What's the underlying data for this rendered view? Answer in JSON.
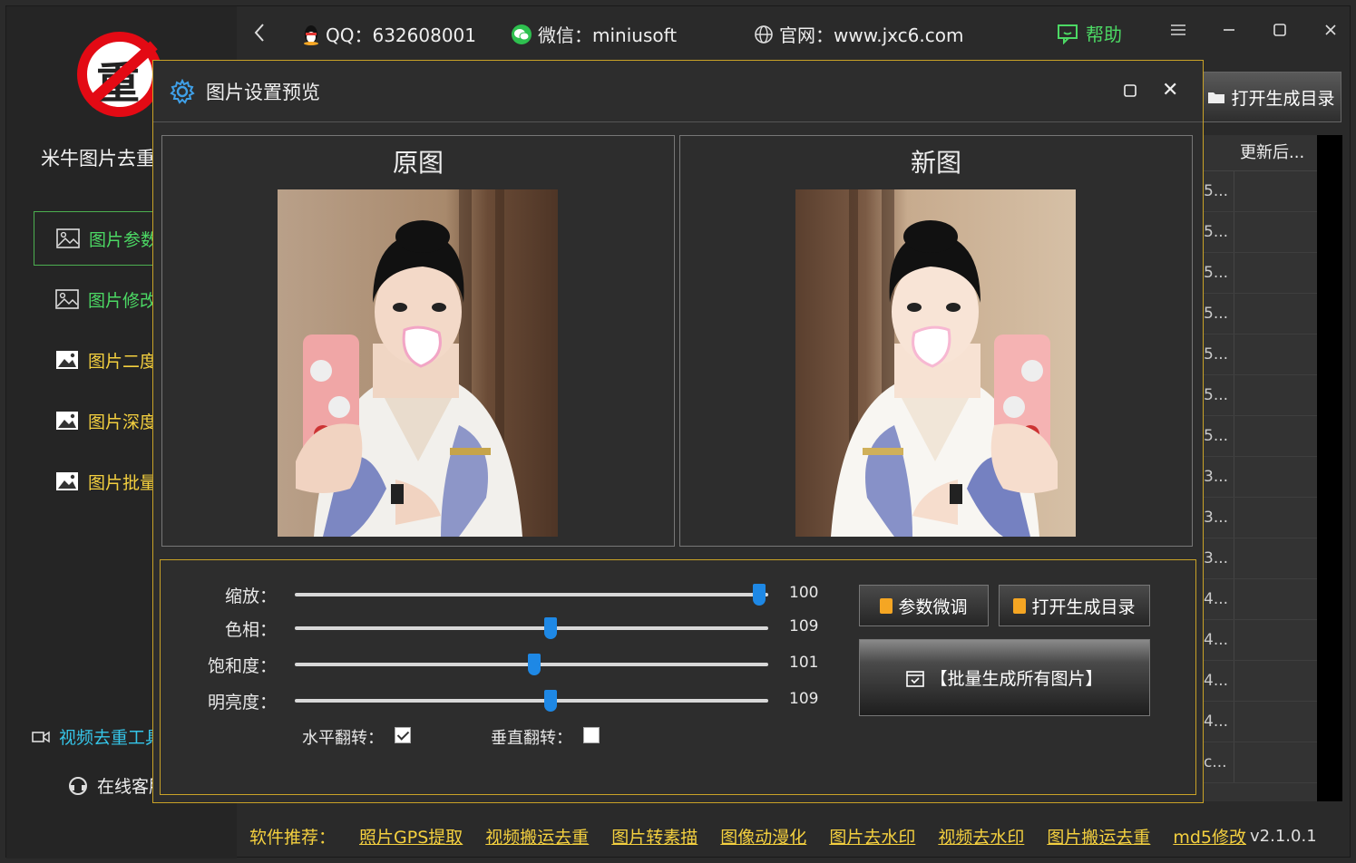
{
  "topbar": {
    "back_icon": "chevron-left-icon",
    "qq": "QQ：632608001",
    "wechat": "微信：miniusoft",
    "website": "官网：www.jxc6.com",
    "help": "帮助"
  },
  "sidebar": {
    "app_name": "米牛图片去重",
    "items": [
      {
        "label": "图片参数",
        "icon": "image-outline-icon"
      },
      {
        "label": "图片修改",
        "icon": "image-outline-icon"
      },
      {
        "label": "图片二度",
        "icon": "image-filled-icon"
      },
      {
        "label": "图片深度",
        "icon": "image-filled-icon"
      },
      {
        "label": "图片批量",
        "icon": "image-filled-icon"
      }
    ],
    "video_item": "视频去重工具",
    "online_item": "在线客服"
  },
  "right_panel": {
    "open_dir": "打开生成目录",
    "header": "更新后...",
    "rows": [
      "5...",
      "5...",
      "5...",
      "5...",
      "5...",
      "5...",
      "5...",
      "3...",
      "3...",
      "3...",
      "4...",
      "4...",
      "4...",
      "4...",
      "c..."
    ]
  },
  "dialog": {
    "title": "图片设置预览",
    "original_caption": "原图",
    "new_caption": "新图",
    "sliders": [
      {
        "label": "缩放：",
        "value": 100,
        "fraction": 0.98
      },
      {
        "label": "色相：",
        "value": 109,
        "fraction": 0.54
      },
      {
        "label": "饱和度：",
        "value": 101,
        "fraction": 0.505
      },
      {
        "label": "明亮度：",
        "value": 109,
        "fraction": 0.54
      }
    ],
    "flip_h_label": "水平翻转：",
    "flip_h_checked": true,
    "flip_v_label": "垂直翻转：",
    "flip_v_checked": false,
    "btn_fine_tune": "参数微调",
    "btn_open_dir": "打开生成目录",
    "btn_batch": "【批量生成所有图片】"
  },
  "footer": {
    "label": "软件推荐：",
    "links": [
      "照片GPS提取",
      "视频搬运去重",
      "图片转素描",
      "图像动漫化",
      "图片去水印",
      "视频去水印",
      "图片搬运去重",
      "md5修改"
    ],
    "version": "v2.1.0.1"
  },
  "colors": {
    "accent_green": "#4cd964",
    "accent_yellow": "#f4d03f",
    "dialog_border": "#c9a227",
    "slider_thumb": "#1e88e5"
  }
}
